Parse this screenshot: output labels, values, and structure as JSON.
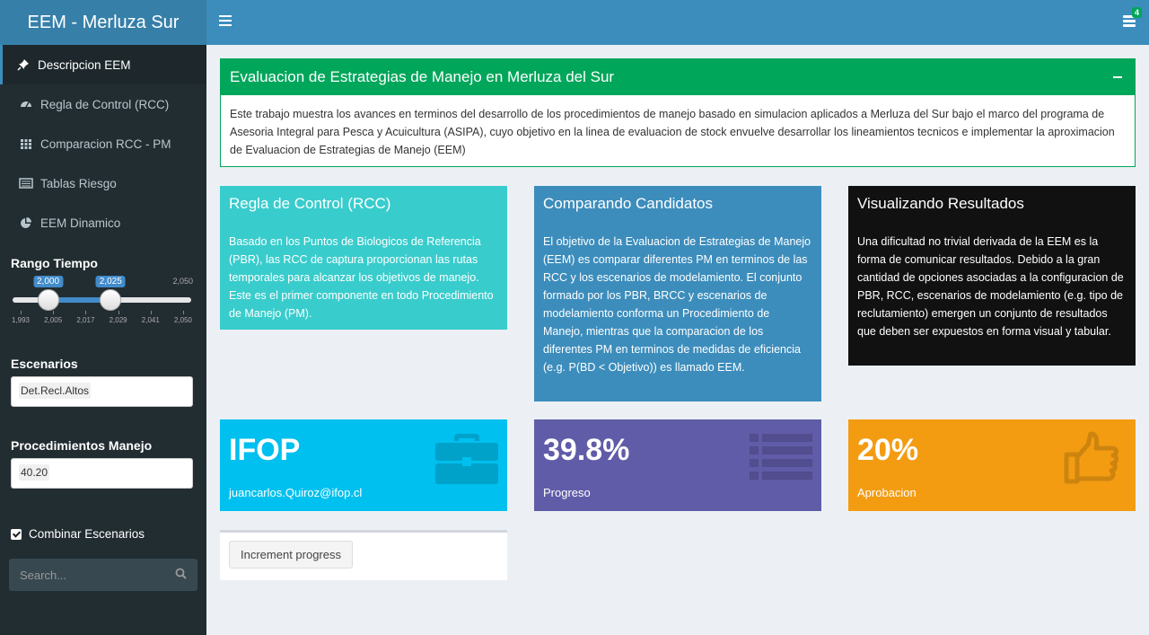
{
  "app": {
    "title": "EEM - Merluza Sur"
  },
  "header": {
    "hamburger_icon": "bars-icon",
    "tasks_icon": "tasks-icon",
    "tasks_badge": "4"
  },
  "sidebar": {
    "items": [
      {
        "label": "Descripcion EEM",
        "icon": "thumbtack-icon",
        "active": true
      },
      {
        "label": "Regla de Control (RCC)",
        "icon": "dashboard-icon"
      },
      {
        "label": "Comparacion RCC - PM",
        "icon": "th-icon"
      },
      {
        "label": "Tablas Riesgo",
        "icon": "table-icon"
      },
      {
        "label": "EEM Dinamico",
        "icon": "pie-chart-icon"
      }
    ],
    "range": {
      "label": "Rango Tiempo",
      "min": 1993,
      "max": 2050,
      "from": 2000,
      "to": 2025,
      "from_label": "2,000",
      "to_label": "2,025",
      "max_label": "2,050",
      "ticks": [
        "1,993",
        "2,005",
        "2,017",
        "2,029",
        "2,041",
        "2,050"
      ]
    },
    "escenarios": {
      "label": "Escenarios",
      "value": "Det.Recl.Altos"
    },
    "procedimientos": {
      "label": "Procedimientos Manejo",
      "value": "40.20"
    },
    "combinar": {
      "label": "Combinar Escenarios",
      "checked": true
    },
    "search": {
      "placeholder": "Search..."
    }
  },
  "description": {
    "title": "Evaluacion de Estrategias de Manejo en Merluza del Sur",
    "text": "Este trabajo muestra los avances en terminos del desarrollo de los procedimientos de manejo basado en simulacion aplicados a Merluza del Sur bajo el marco del programa de Asesoria Integral para Pesca y Acuicultura (ASIPA), cuyo objetivo en la linea de evaluacion de stock envuelve desarrollar los lineamientos tecnicos e implementar la aproximacion de Evaluacion de Estrategias de Manejo (EEM)"
  },
  "info_boxes": [
    {
      "title": "Regla de Control (RCC)",
      "text": "Basado en los Puntos de Biologicos de Referencia (PBR), las RCC de captura proporcionan las rutas temporales para alcanzar los objetivos de manejo. Este es el primer componente en todo Procedimiento de Manejo (PM).",
      "color": "#39cccc"
    },
    {
      "title": "Comparando Candidatos",
      "text": "El objetivo de la Evaluacion de Estrategias de Manejo (EEM) es comparar diferentes PM en terminos de las RCC y los escenarios de modelamiento. El conjunto formado por los PBR, BRCC y escenarios de modelamiento conforma un Procedimiento de Manejo, mientras que la comparacion de los diferentes PM en terminos de medidas de eficiencia (e.g. P(BD < Objetivo)) es llamado EEM.",
      "color": "#3c8dbc"
    },
    {
      "title": "Visualizando Resultados",
      "text": "Una dificultad no trivial derivada de la EEM es la forma de comunicar resultados. Debido a la gran cantidad de opciones asociadas a la configuracion de PBR, RCC, escenarios de modelamiento (e.g. tipo de reclutamiento) emergen un conjunto de resultados que deben ser expuestos en forma visual y tabular.",
      "color": "#111111"
    }
  ],
  "value_boxes": [
    {
      "value": "IFOP",
      "subtitle": "juancarlos.Quiroz@ifop.cl",
      "icon": "briefcase-icon",
      "color": "#00c0ef"
    },
    {
      "value": "39.8%",
      "subtitle": "Progreso",
      "icon": "list-icon",
      "color": "#605ca8"
    },
    {
      "value": "20%",
      "subtitle": "Aprobacion",
      "icon": "thumbs-up-icon",
      "color": "#f39c12"
    }
  ],
  "actions": {
    "increment_label": "Increment progress"
  }
}
